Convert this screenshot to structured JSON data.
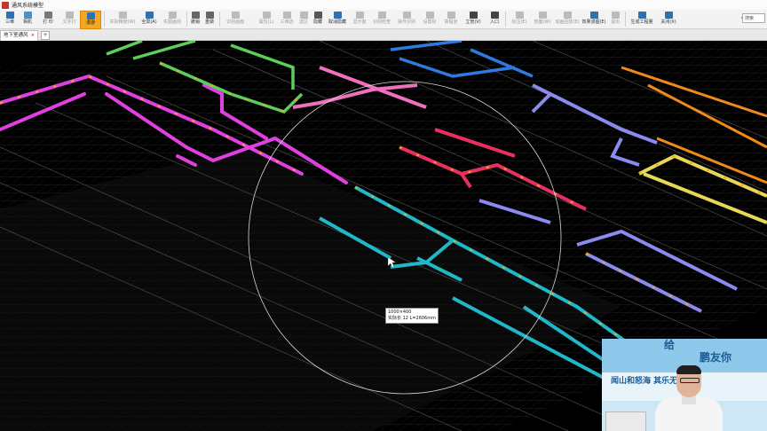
{
  "window": {
    "title": "通风系统模型"
  },
  "toolbar": {
    "items": [
      {
        "label": "三维",
        "state": "normal",
        "color": "#2f6fb3"
      },
      {
        "label": "相机",
        "state": "normal",
        "color": "#2f6fb3"
      },
      {
        "label": "打 印",
        "state": "normal",
        "color": "#555555"
      },
      {
        "label": "文字打",
        "state": "disabled",
        "color": "#999999"
      },
      {
        "label": "漫游",
        "state": "active",
        "color": "#2f6fb3"
      },
      {
        "label": "实际精度(W)",
        "state": "disabled",
        "color": "#999999"
      },
      {
        "label": "全屏(A)",
        "state": "normal",
        "color": "#2f6fb3"
      },
      {
        "label": "实图画线",
        "state": "disabled",
        "color": "#999999"
      },
      {
        "label": "撤销",
        "state": "normal",
        "color": "#555555"
      },
      {
        "label": "重做",
        "state": "normal",
        "color": "#555555"
      },
      {
        "label": "识别画面",
        "state": "disabled",
        "color": "#999999"
      },
      {
        "label": "属性(L)",
        "state": "disabled",
        "color": "#999999"
      },
      {
        "label": "三维选",
        "state": "disabled",
        "color": "#999999"
      },
      {
        "label": "选区",
        "state": "disabled",
        "color": "#999999"
      },
      {
        "label": "隐藏",
        "state": "normal",
        "color": "#333333"
      },
      {
        "label": "取消隐藏",
        "state": "normal",
        "color": "#2f6fb3"
      },
      {
        "label": "显示窗",
        "state": "disabled",
        "color": "#999999"
      },
      {
        "label": "识别检查",
        "state": "disabled",
        "color": "#999999"
      },
      {
        "label": "操作识别",
        "state": "disabled",
        "color": "#999999"
      },
      {
        "label": "设置标",
        "state": "disabled",
        "color": "#999999"
      },
      {
        "label": "高程坐",
        "state": "disabled",
        "color": "#999999"
      },
      {
        "label": "立管(V)",
        "state": "normal",
        "color": "#333333"
      },
      {
        "label": "入口",
        "state": "normal",
        "color": "#333333"
      },
      {
        "label": "标注(E)",
        "state": "disabled",
        "color": "#999999"
      },
      {
        "label": "剖面(W)",
        "state": "disabled",
        "color": "#999999"
      },
      {
        "label": "动画回放(E)",
        "state": "disabled",
        "color": "#999999"
      },
      {
        "label": "效果漫图(E)",
        "state": "normal",
        "color": "#2f6fb3"
      },
      {
        "label": "退出",
        "state": "disabled",
        "color": "#999999"
      },
      {
        "label": "生成工程量",
        "state": "normal",
        "color": "#2f6fb3"
      },
      {
        "label": "关闭(X)",
        "state": "normal",
        "color": "#2f6fb3"
      }
    ],
    "search_placeholder": "搜索"
  },
  "tabs": [
    {
      "label": "地下室通风"
    }
  ],
  "viewport": {
    "tooltip_line1": "1000×400",
    "tooltip_line2": "实际长 12  L=2606mm"
  },
  "webcam": {
    "banner_text_1": "给",
    "banner_text_2": "鹏友你",
    "board_text": "闻山和怒海  其乐无穷"
  },
  "colors": {
    "duct_magenta": "#e040e0",
    "duct_cyan": "#1fb8c8",
    "duct_green": "#5ad05a",
    "duct_blue": "#2e7be0",
    "duct_orange": "#f08a1a",
    "duct_yellow": "#e8d85a",
    "duct_periwinkle": "#8a8af0",
    "duct_red": "#e83060",
    "duct_pink": "#f070c0",
    "active_tool": "#f5a623"
  }
}
